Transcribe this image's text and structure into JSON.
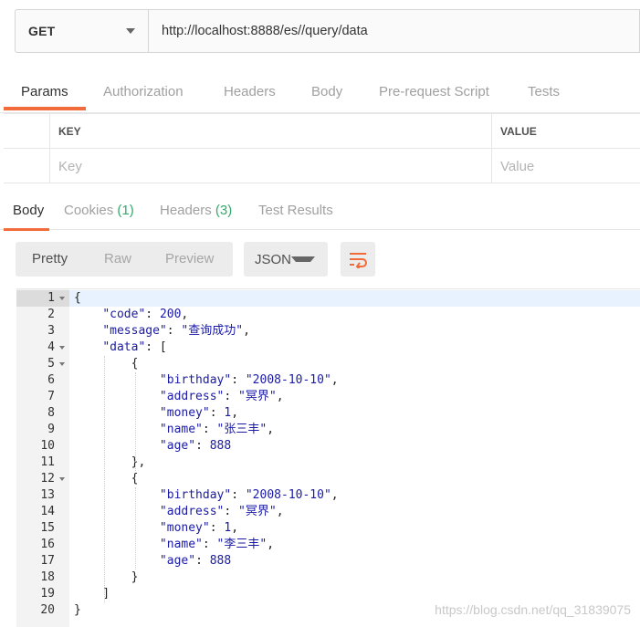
{
  "request": {
    "method": "GET",
    "url": "http://localhost:8888/es//query/data"
  },
  "request_tabs": [
    "Params",
    "Authorization",
    "Headers",
    "Body",
    "Pre-request Script",
    "Tests"
  ],
  "params": {
    "headers": {
      "key": "KEY",
      "value": "VALUE"
    },
    "placeholders": {
      "key": "Key",
      "value": "Value"
    }
  },
  "response_tabs": [
    {
      "label": "Body",
      "count": ""
    },
    {
      "label": "Cookies",
      "count": "(1)"
    },
    {
      "label": "Headers",
      "count": "(3)"
    },
    {
      "label": "Test Results",
      "count": ""
    }
  ],
  "view": {
    "modes": [
      "Pretty",
      "Raw",
      "Preview"
    ],
    "active": "Pretty",
    "format": "JSON",
    "wrap_icon": "wrap-lines-icon"
  },
  "code_lines": [
    "{",
    "    \"code\": 200,",
    "    \"message\": \"查询成功\",",
    "    \"data\": [",
    "        {",
    "            \"birthday\": \"2008-10-10\",",
    "            \"address\": \"冥界\",",
    "            \"money\": 1,",
    "            \"name\": \"张三丰\",",
    "            \"age\": 888",
    "        },",
    "        {",
    "            \"birthday\": \"2008-10-10\",",
    "            \"address\": \"冥界\",",
    "            \"money\": 1,",
    "            \"name\": \"李三丰\",",
    "            \"age\": 888",
    "        }",
    "    ]",
    "}"
  ],
  "fold_lines": [
    1,
    4,
    5,
    12
  ],
  "watermark": "https://blog.csdn.net/qq_31839075",
  "colors": {
    "accent": "#f26b3a",
    "count": "#35a86d",
    "json_value": "#1a1aa6"
  }
}
